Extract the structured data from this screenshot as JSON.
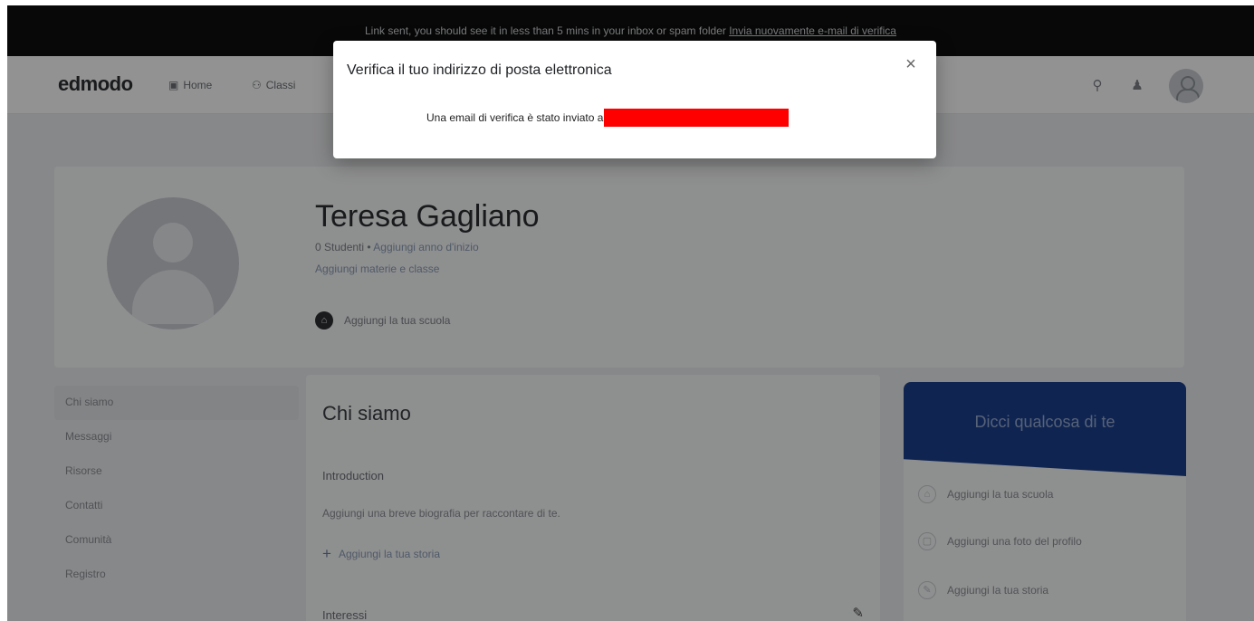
{
  "banner": {
    "text": "Link sent, you should see it in less than 5 mins in your inbox or spam folder ",
    "resend_text": "Invia nuovamente e-mail di verifica"
  },
  "nav": {
    "logo": "edmodo",
    "home_label": "Home",
    "classes_label": "Classi",
    "search_icon": "search-icon",
    "notifications_icon": "bell-icon"
  },
  "profile": {
    "name": "Teresa Gagliano",
    "students": "0 Studenti",
    "separator": "•",
    "add_start_year": "Aggiungi anno d'inizio",
    "add_subjects": "Aggiungi materie e classe",
    "add_school": "Aggiungi la tua scuola"
  },
  "sidemenu": {
    "items": [
      {
        "label": "Chi siamo"
      },
      {
        "label": "Messaggi"
      },
      {
        "label": "Risorse"
      },
      {
        "label": "Contatti"
      },
      {
        "label": "Comunità"
      },
      {
        "label": "Registro"
      }
    ]
  },
  "about": {
    "title": "Chi siamo",
    "intro_heading": "Introduction",
    "intro_desc": "Aggiungi una breve biografia per raccontare di te.",
    "add_story": "Aggiungi la tua storia",
    "interests_heading": "Interessi"
  },
  "tellcard": {
    "title": "Dicci qualcosa di te",
    "items": [
      {
        "label": "Aggiungi la tua scuola",
        "icon": "school-icon"
      },
      {
        "label": "Aggiungi una foto del profilo",
        "icon": "photo-icon"
      },
      {
        "label": "Aggiungi la tua storia",
        "icon": "pencil-icon"
      }
    ]
  },
  "modal": {
    "title": "Verifica il tuo indirizzo di posta elettronica",
    "body": "Una email di verifica è stato inviato a",
    "close_symbol": "×"
  },
  "colors": {
    "overlay": "#000000",
    "brand_blue": "#1b3e8c",
    "redaction": "#ff0000"
  }
}
